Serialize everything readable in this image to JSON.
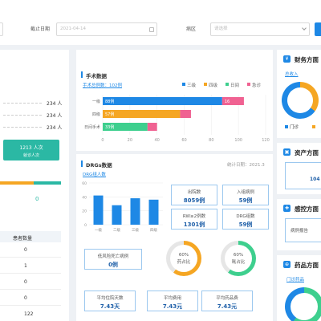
{
  "filters": {
    "stat_date_label": "截止日期",
    "stat_date_value": "2021-04-14",
    "dept_label": "病区",
    "dept_placeholder": "请选择"
  },
  "left_panel": {
    "rows": [
      {
        "value": "234 人"
      },
      {
        "value": "234 人"
      },
      {
        "value": "234 人"
      }
    ],
    "highlight_value": "1213 人次",
    "highlight_label": "就诊人次",
    "gauge_value": "0",
    "table_header": "患者数量",
    "table_values": [
      "0",
      "1",
      "0",
      "0",
      "122"
    ]
  },
  "surgery": {
    "title": "手术数据",
    "subtitle": "手术总例数：102例",
    "legend": [
      {
        "name": "三级",
        "color": "#1e88e5"
      },
      {
        "name": "四级",
        "color": "#f5a623"
      },
      {
        "name": "日间",
        "color": "#3ecf8e"
      },
      {
        "name": "急诊",
        "color": "#f06292"
      }
    ],
    "rows": [
      {
        "label": "一级",
        "segments": [
          {
            "value": 88,
            "text": "88例",
            "color": "#1e88e5"
          },
          {
            "value": 16,
            "text": "16",
            "color": "#f06292"
          }
        ]
      },
      {
        "label": "四级",
        "segments": [
          {
            "value": 57,
            "text": "57例",
            "color": "#f5a623"
          },
          {
            "value": 8,
            "text": "",
            "color": "#f06292"
          }
        ]
      },
      {
        "label": "日间手术",
        "segments": [
          {
            "value": 33,
            "text": "33例",
            "color": "#3ecf8e"
          },
          {
            "value": 7,
            "text": "",
            "color": "#f06292"
          }
        ]
      }
    ],
    "x_ticks": [
      "0",
      "20",
      "40",
      "60",
      "80",
      "100",
      "120"
    ],
    "xmax": 120
  },
  "drg": {
    "title": "DRGs数据",
    "date_note": "统计日期：2021.3",
    "chart_title": "DRG组人数",
    "chart_data": {
      "type": "bar",
      "categories": [
        "一级",
        "二级",
        "三级",
        "四级"
      ],
      "values": [
        42,
        28,
        38,
        36
      ],
      "ylim": [
        0,
        60
      ],
      "ticks": [
        "60",
        "40",
        "20",
        "0"
      ]
    },
    "boxes": [
      {
        "label": "出院数",
        "value": "8059例"
      },
      {
        "label": "入组病例",
        "value": "59例"
      },
      {
        "label": "RW≥2例数",
        "value": "1301例"
      },
      {
        "label": "DRG组数",
        "value": "59例"
      }
    ],
    "rings": [
      {
        "percent": "60%",
        "label": "药占比",
        "fraction": 0.6,
        "color": "#f5a623"
      },
      {
        "percent": "60%",
        "label": "耗占比",
        "fraction": 0.6,
        "color": "#3ecf8e"
      }
    ],
    "left_box": {
      "label": "低风险死亡病例",
      "value": "0例"
    },
    "bottom_boxes": [
      {
        "label": "平均住院天数",
        "value": "7.43天"
      },
      {
        "label": "平均费用",
        "value": "7.43元"
      },
      {
        "label": "平均药品费",
        "value": "7.43元"
      }
    ]
  },
  "right_panel": {
    "finance": {
      "title": "财务方面",
      "link": "总收入",
      "legend": [
        "门诊"
      ]
    },
    "assets": {
      "title": "资产方面",
      "value": "104"
    },
    "infection": {
      "title": "感控方面",
      "link": "病例报告"
    },
    "drug": {
      "title": "药品方面",
      "link": "门诊药品"
    }
  }
}
